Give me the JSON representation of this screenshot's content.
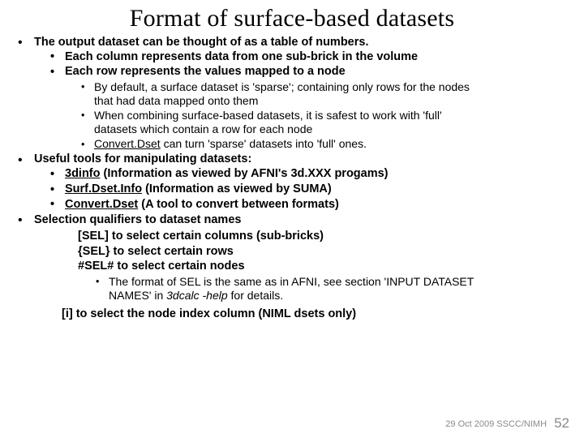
{
  "title": "Format of surface-based datasets",
  "b1": {
    "line": "The output dataset can be thought of as a table of numbers.",
    "s1": "Each column represents data from one sub-brick in the volume",
    "s2": "Each row represents the values mapped to a node",
    "d1a": "By default, a surface dataset is 'sparse'; containing only rows for the nodes",
    "d1b": "that had data mapped onto them",
    "d2a": "When combining surface-based datasets, it is safest to work with 'full'",
    "d2b": "datasets which contain a row for each node",
    "d3a": "Convert.Dset",
    "d3b": " can turn 'sparse' datasets into 'full' ones."
  },
  "b2": {
    "line": "Useful tools for manipulating datasets:",
    "i1a": "3dinfo",
    "i1b": " (Information as viewed by AFNI's ",
    "i1c": "3d.XXX",
    "i1d": " progams)",
    "i2a": "Surf.Dset.Info",
    "i2b": " (Information as viewed by SUMA)",
    "i3a": "Convert.Dset",
    "i3b": " (A tool to convert between formats)"
  },
  "b3": {
    "line": "Selection qualifiers to dataset names",
    "s1a": "[SEL]",
    "s1b": " to select certain columns (sub-bricks)",
    "s2a": "{SEL}",
    "s2b": " to select certain rows",
    "s3a": "#SEL#",
    "s3b": " to select certain nodes",
    "n1a": "The format of SEL is the same as in AFNI, see section 'INPUT DATASET",
    "n1b": "NAMES' in ",
    "n1c": "3dcalc -help",
    "n1d": " for details.",
    "i_a": "[i]",
    "i_b": " to select the node index column (NIML dsets only)"
  },
  "footer": {
    "text": "29 Oct 2009 SSCC/NIMH",
    "page": "52"
  }
}
